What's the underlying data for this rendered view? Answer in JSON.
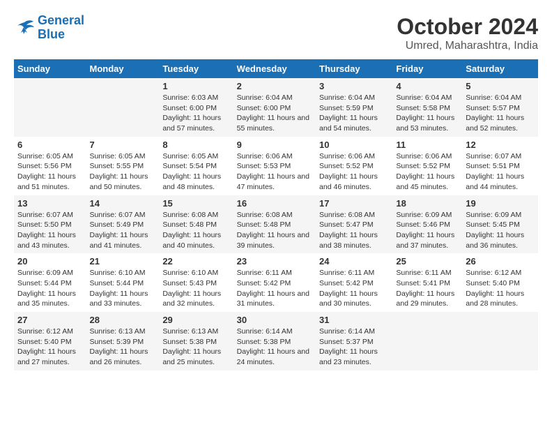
{
  "header": {
    "logo_line1": "General",
    "logo_line2": "Blue",
    "title": "October 2024",
    "subtitle": "Umred, Maharashtra, India"
  },
  "days_of_week": [
    "Sunday",
    "Monday",
    "Tuesday",
    "Wednesday",
    "Thursday",
    "Friday",
    "Saturday"
  ],
  "weeks": [
    [
      {
        "day": "",
        "info": ""
      },
      {
        "day": "",
        "info": ""
      },
      {
        "day": "1",
        "info": "Sunrise: 6:03 AM\nSunset: 6:00 PM\nDaylight: 11 hours and 57 minutes."
      },
      {
        "day": "2",
        "info": "Sunrise: 6:04 AM\nSunset: 6:00 PM\nDaylight: 11 hours and 55 minutes."
      },
      {
        "day": "3",
        "info": "Sunrise: 6:04 AM\nSunset: 5:59 PM\nDaylight: 11 hours and 54 minutes."
      },
      {
        "day": "4",
        "info": "Sunrise: 6:04 AM\nSunset: 5:58 PM\nDaylight: 11 hours and 53 minutes."
      },
      {
        "day": "5",
        "info": "Sunrise: 6:04 AM\nSunset: 5:57 PM\nDaylight: 11 hours and 52 minutes."
      }
    ],
    [
      {
        "day": "6",
        "info": "Sunrise: 6:05 AM\nSunset: 5:56 PM\nDaylight: 11 hours and 51 minutes."
      },
      {
        "day": "7",
        "info": "Sunrise: 6:05 AM\nSunset: 5:55 PM\nDaylight: 11 hours and 50 minutes."
      },
      {
        "day": "8",
        "info": "Sunrise: 6:05 AM\nSunset: 5:54 PM\nDaylight: 11 hours and 48 minutes."
      },
      {
        "day": "9",
        "info": "Sunrise: 6:06 AM\nSunset: 5:53 PM\nDaylight: 11 hours and 47 minutes."
      },
      {
        "day": "10",
        "info": "Sunrise: 6:06 AM\nSunset: 5:52 PM\nDaylight: 11 hours and 46 minutes."
      },
      {
        "day": "11",
        "info": "Sunrise: 6:06 AM\nSunset: 5:52 PM\nDaylight: 11 hours and 45 minutes."
      },
      {
        "day": "12",
        "info": "Sunrise: 6:07 AM\nSunset: 5:51 PM\nDaylight: 11 hours and 44 minutes."
      }
    ],
    [
      {
        "day": "13",
        "info": "Sunrise: 6:07 AM\nSunset: 5:50 PM\nDaylight: 11 hours and 43 minutes."
      },
      {
        "day": "14",
        "info": "Sunrise: 6:07 AM\nSunset: 5:49 PM\nDaylight: 11 hours and 41 minutes."
      },
      {
        "day": "15",
        "info": "Sunrise: 6:08 AM\nSunset: 5:48 PM\nDaylight: 11 hours and 40 minutes."
      },
      {
        "day": "16",
        "info": "Sunrise: 6:08 AM\nSunset: 5:48 PM\nDaylight: 11 hours and 39 minutes."
      },
      {
        "day": "17",
        "info": "Sunrise: 6:08 AM\nSunset: 5:47 PM\nDaylight: 11 hours and 38 minutes."
      },
      {
        "day": "18",
        "info": "Sunrise: 6:09 AM\nSunset: 5:46 PM\nDaylight: 11 hours and 37 minutes."
      },
      {
        "day": "19",
        "info": "Sunrise: 6:09 AM\nSunset: 5:45 PM\nDaylight: 11 hours and 36 minutes."
      }
    ],
    [
      {
        "day": "20",
        "info": "Sunrise: 6:09 AM\nSunset: 5:44 PM\nDaylight: 11 hours and 35 minutes."
      },
      {
        "day": "21",
        "info": "Sunrise: 6:10 AM\nSunset: 5:44 PM\nDaylight: 11 hours and 33 minutes."
      },
      {
        "day": "22",
        "info": "Sunrise: 6:10 AM\nSunset: 5:43 PM\nDaylight: 11 hours and 32 minutes."
      },
      {
        "day": "23",
        "info": "Sunrise: 6:11 AM\nSunset: 5:42 PM\nDaylight: 11 hours and 31 minutes."
      },
      {
        "day": "24",
        "info": "Sunrise: 6:11 AM\nSunset: 5:42 PM\nDaylight: 11 hours and 30 minutes."
      },
      {
        "day": "25",
        "info": "Sunrise: 6:11 AM\nSunset: 5:41 PM\nDaylight: 11 hours and 29 minutes."
      },
      {
        "day": "26",
        "info": "Sunrise: 6:12 AM\nSunset: 5:40 PM\nDaylight: 11 hours and 28 minutes."
      }
    ],
    [
      {
        "day": "27",
        "info": "Sunrise: 6:12 AM\nSunset: 5:40 PM\nDaylight: 11 hours and 27 minutes."
      },
      {
        "day": "28",
        "info": "Sunrise: 6:13 AM\nSunset: 5:39 PM\nDaylight: 11 hours and 26 minutes."
      },
      {
        "day": "29",
        "info": "Sunrise: 6:13 AM\nSunset: 5:38 PM\nDaylight: 11 hours and 25 minutes."
      },
      {
        "day": "30",
        "info": "Sunrise: 6:14 AM\nSunset: 5:38 PM\nDaylight: 11 hours and 24 minutes."
      },
      {
        "day": "31",
        "info": "Sunrise: 6:14 AM\nSunset: 5:37 PM\nDaylight: 11 hours and 23 minutes."
      },
      {
        "day": "",
        "info": ""
      },
      {
        "day": "",
        "info": ""
      }
    ]
  ]
}
